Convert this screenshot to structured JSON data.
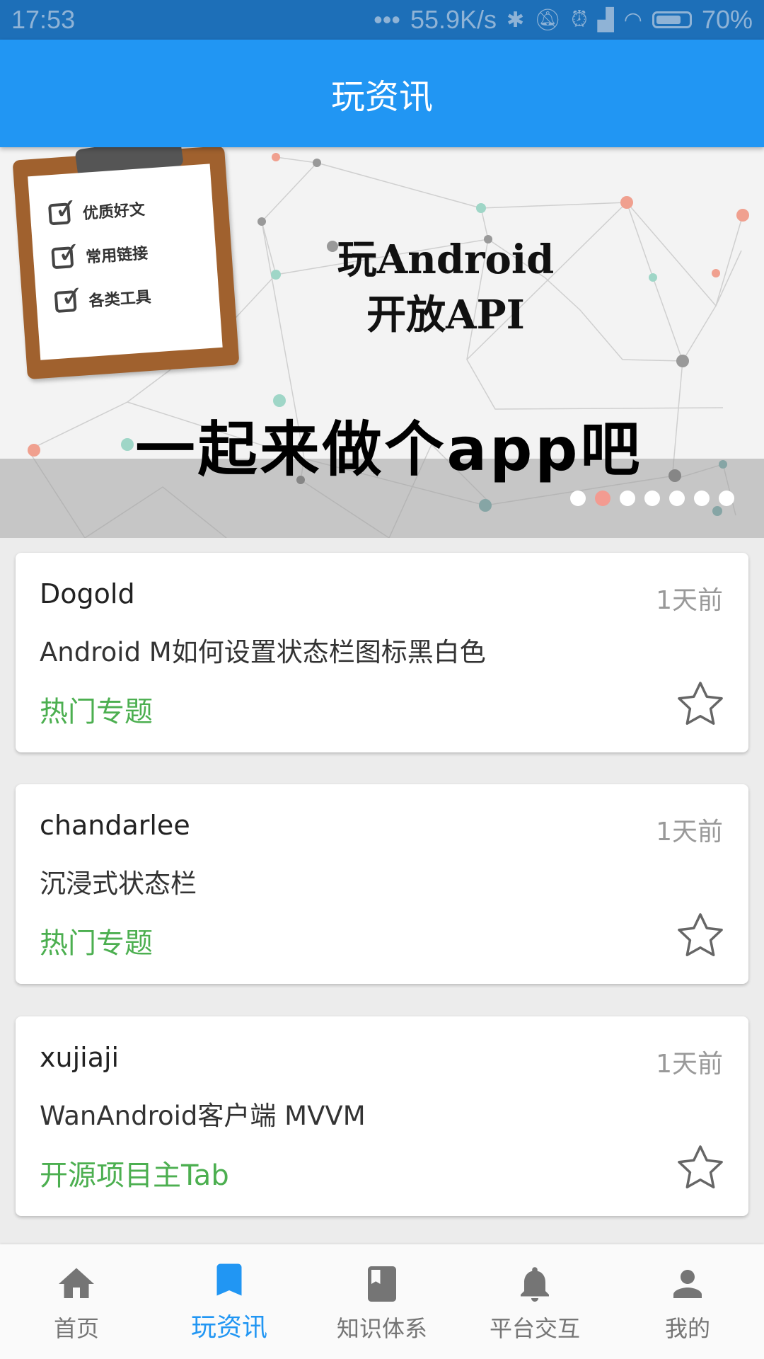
{
  "status_bar": {
    "time": "17:53",
    "dots": "•••",
    "network_speed": "55.9K/s",
    "battery_percent": "70%",
    "icons": [
      "bluetooth-icon",
      "mute-icon",
      "alarm-icon",
      "signal-icon",
      "wifi-icon",
      "battery-icon"
    ]
  },
  "app_bar": {
    "title": "玩资讯"
  },
  "banner": {
    "checklist": [
      "优质好文",
      "常用链接",
      "各类工具"
    ],
    "title_line1": "玩Android",
    "title_line2": "开放API",
    "slogan": "一起来做个app吧",
    "active_index": 1,
    "page_count": 7
  },
  "articles": [
    {
      "author": "Dogold",
      "time": "1天前",
      "title": "Android M如何设置状态栏图标黑白色",
      "chapter": "热门专题"
    },
    {
      "author": "chandarlee",
      "time": "1天前",
      "title": "沉浸式状态栏",
      "chapter": "热门专题"
    },
    {
      "author": "xujiaji",
      "time": "1天前",
      "title": "WanAndroid客户端 MVVM",
      "chapter": "开源项目主Tab"
    }
  ],
  "bottom_nav": [
    {
      "label": "首页",
      "icon": "home-icon"
    },
    {
      "label": "玩资讯",
      "icon": "bookmark-icon"
    },
    {
      "label": "知识体系",
      "icon": "book-icon"
    },
    {
      "label": "平台交互",
      "icon": "bell-icon"
    },
    {
      "label": "我的",
      "icon": "person-icon"
    }
  ],
  "colors": {
    "primary": "#2196f3",
    "status_bar": "#1d6fb8",
    "chapter_green": "#4caf50",
    "indicator_active": "#f39b91"
  }
}
